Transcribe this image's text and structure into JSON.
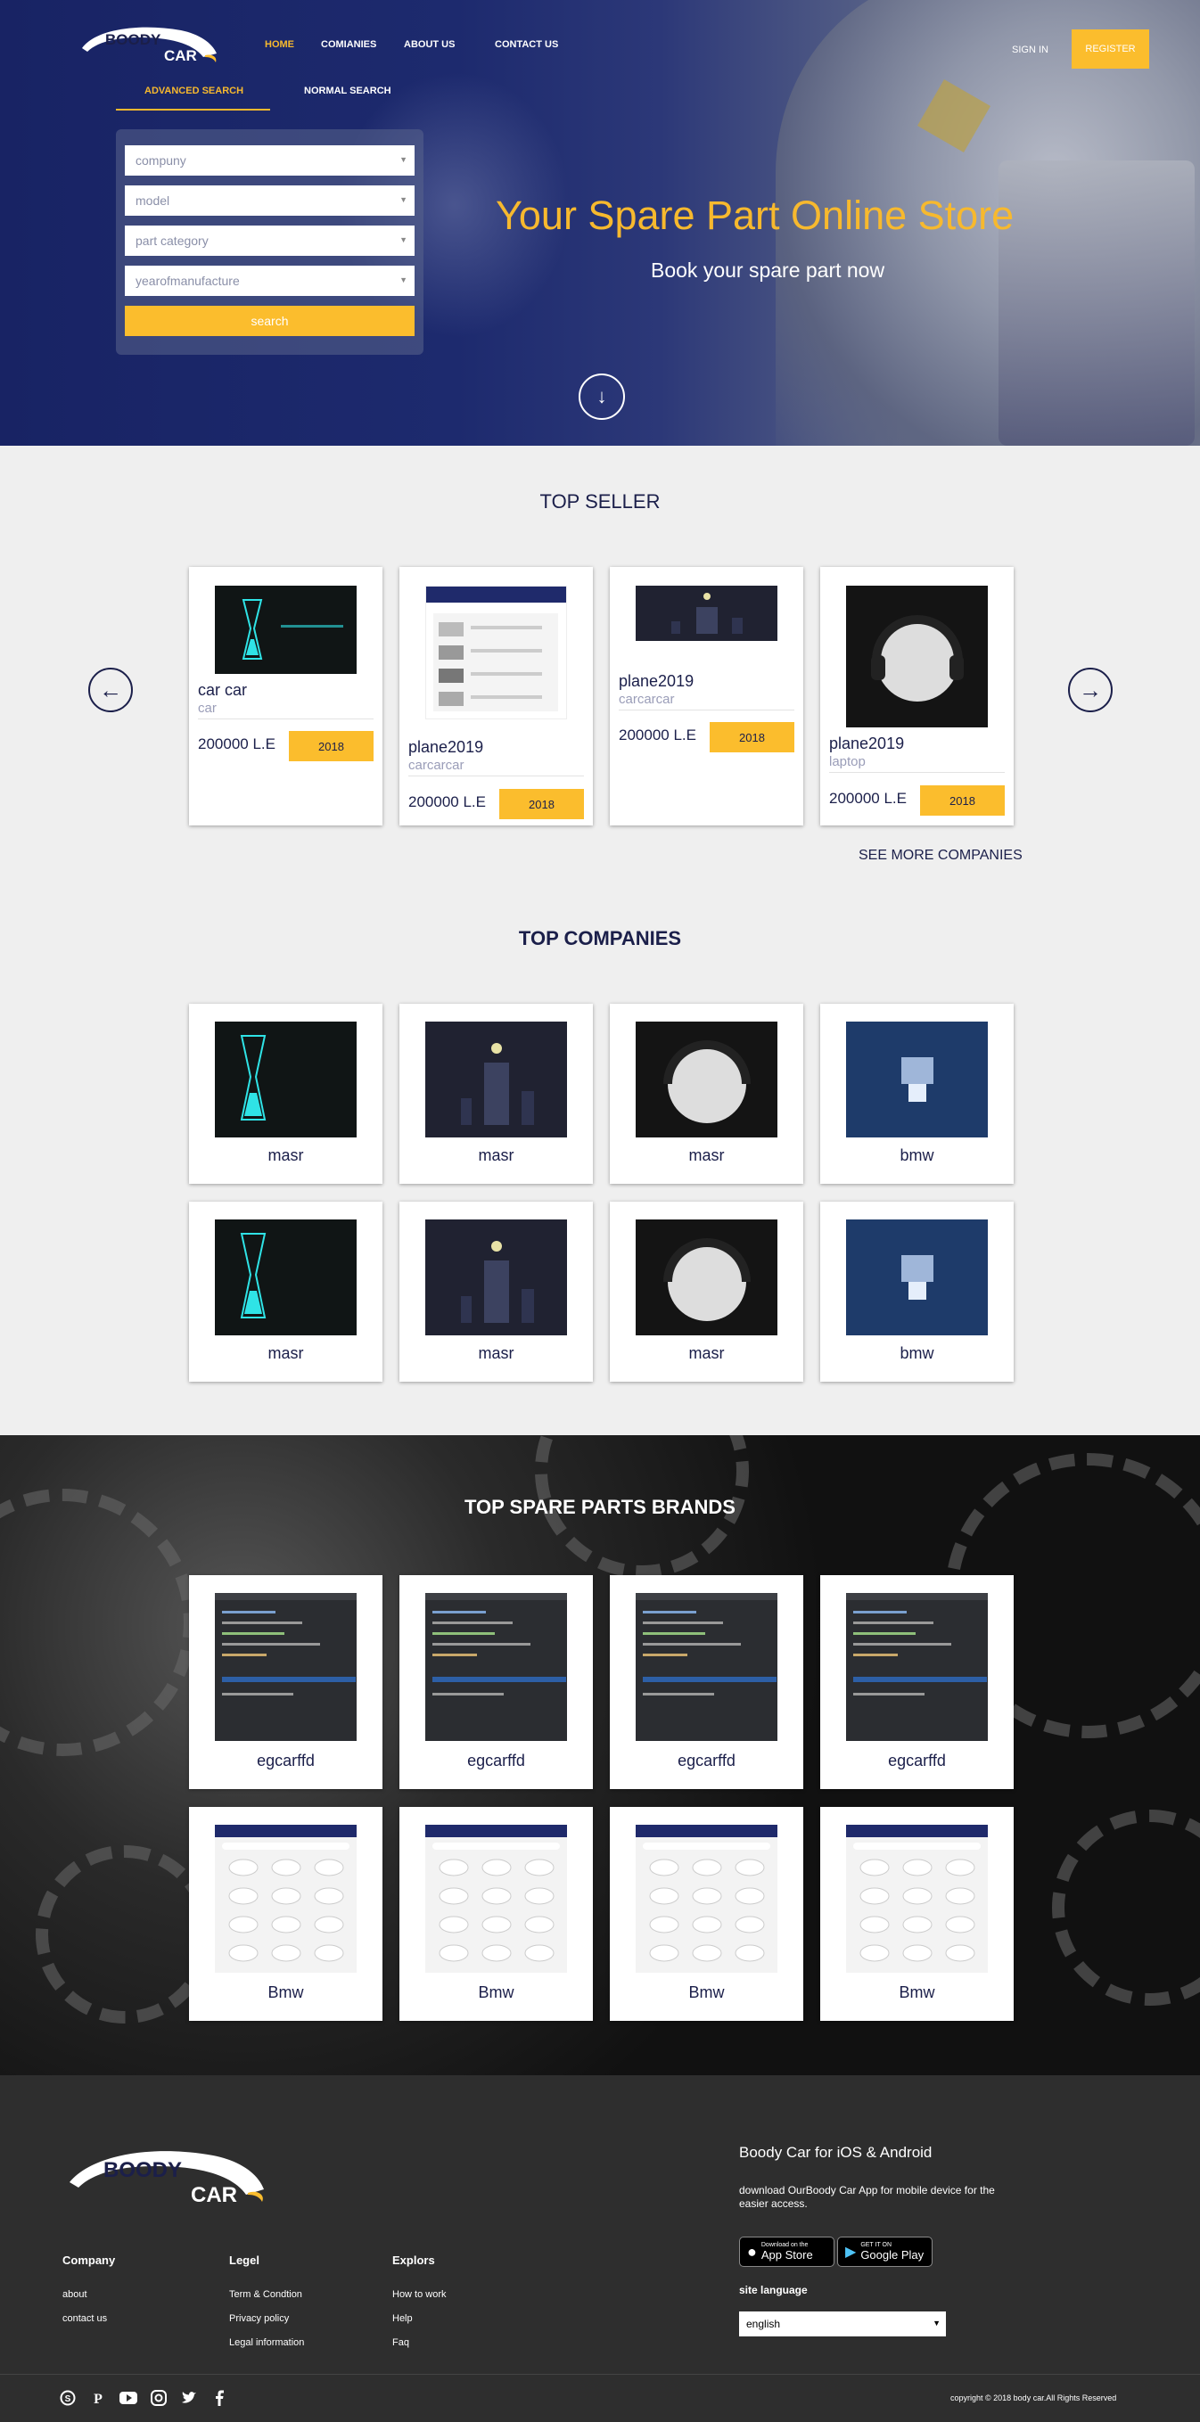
{
  "header": {
    "logo_top": "BOODY",
    "logo_bottom": "CAR",
    "nav": [
      "HOME",
      "COMIANIES",
      "ABOUT US",
      "CONTACT US"
    ],
    "signin": "SIGN IN",
    "register": "REGISTER"
  },
  "search": {
    "tabs": [
      "ADVANCED SEARCH",
      "NORMAL SEARCH"
    ],
    "fields": [
      "compuny",
      "model",
      "part category",
      "yearofmanufacture"
    ],
    "button": "search"
  },
  "hero": {
    "title": "Your Spare Part Online Store",
    "subtitle": "Book your spare part now"
  },
  "top_seller": {
    "title": "TOP SELLER",
    "items": [
      {
        "name": "car car",
        "category": "car",
        "price": "200000 L.E",
        "year": "2018"
      },
      {
        "name": "plane2019",
        "category": "carcarcar",
        "price": "200000 L.E",
        "year": "2018"
      },
      {
        "name": "plane2019",
        "category": "carcarcar",
        "price": "200000 L.E",
        "year": "2018"
      },
      {
        "name": "plane2019",
        "category": "laptop",
        "price": "200000 L.E",
        "year": "2018"
      }
    ],
    "see_more": "SEE MORE COMPANIES"
  },
  "top_companies": {
    "title": "TOP COMPANIES",
    "items": [
      "masr",
      "masr",
      "masr",
      "bmw",
      "masr",
      "masr",
      "masr",
      "bmw"
    ]
  },
  "top_brands": {
    "title": "TOP SPARE PARTS BRANDS",
    "items": [
      "egcarffd",
      "egcarffd",
      "egcarffd",
      "egcarffd",
      "Bmw",
      "Bmw",
      "Bmw",
      "Bmw"
    ]
  },
  "footer": {
    "columns": [
      {
        "title": "Company",
        "links": [
          "about",
          "contact us"
        ]
      },
      {
        "title": "Legel",
        "links": [
          "Term & Condtion",
          "Privacy policy",
          "Legal information"
        ]
      },
      {
        "title": "Explors",
        "links": [
          "How to work",
          "Help",
          "Faq"
        ]
      }
    ],
    "app_title": "Boody Car for iOS & Android",
    "app_desc": "download OurBoody Car App for mobile device for the easier access.",
    "appstore_small": "Download on the",
    "appstore_large": "App Store",
    "googleplay_small": "GET IT ON",
    "googleplay_large": "Google Play",
    "lang_label": "site language",
    "lang_value": "english",
    "social_icons": [
      "skype-icon",
      "pinterest-icon",
      "youtube-icon",
      "instagram-icon",
      "twitter-icon",
      "facebook-icon"
    ],
    "copyright": "copyright © 2018 body car.All Rights Reserved"
  },
  "colors": {
    "accent": "#fbbd2d",
    "navy": "#1b1f4a",
    "footer_bg": "#2e2e2e"
  }
}
